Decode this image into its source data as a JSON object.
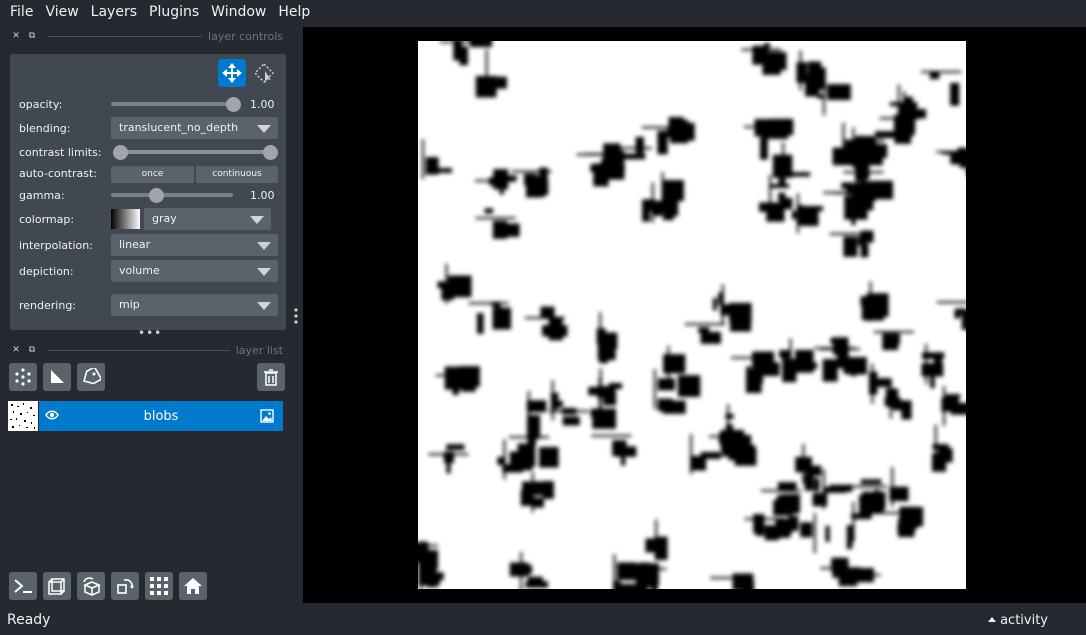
{
  "menubar": {
    "items": [
      {
        "label": "File"
      },
      {
        "label": "View"
      },
      {
        "label": "Layers"
      },
      {
        "label": "Plugins"
      },
      {
        "label": "Window"
      },
      {
        "label": "Help"
      }
    ]
  },
  "layer_controls": {
    "title": "layer controls",
    "opacity": {
      "label": "opacity:",
      "value": "1.00",
      "fraction": 1.0
    },
    "blending": {
      "label": "blending:",
      "value": "translucent_no_depth"
    },
    "contrast_limits": {
      "label": "contrast limits:",
      "low_fraction": 0.0,
      "high_fraction": 1.0
    },
    "auto_contrast": {
      "label": "auto-contrast:",
      "once": "once",
      "continuous": "continuous"
    },
    "gamma": {
      "label": "gamma:",
      "value": "1.00",
      "fraction": 0.37
    },
    "colormap": {
      "label": "colormap:",
      "value": "gray"
    },
    "interpolation": {
      "label": "interpolation:",
      "value": "linear"
    },
    "depiction": {
      "label": "depiction:",
      "value": "volume"
    },
    "rendering": {
      "label": "rendering:",
      "value": "mip"
    }
  },
  "layer_list": {
    "title": "layer list",
    "layers": [
      {
        "name": "blobs",
        "selected": true,
        "visible": true
      }
    ]
  },
  "status": {
    "text": "Ready",
    "activity": "activity"
  },
  "colors": {
    "background": "#262930",
    "panel": "#414851",
    "control": "#5a626c",
    "accent": "#007acc",
    "canvas": "#000000"
  }
}
